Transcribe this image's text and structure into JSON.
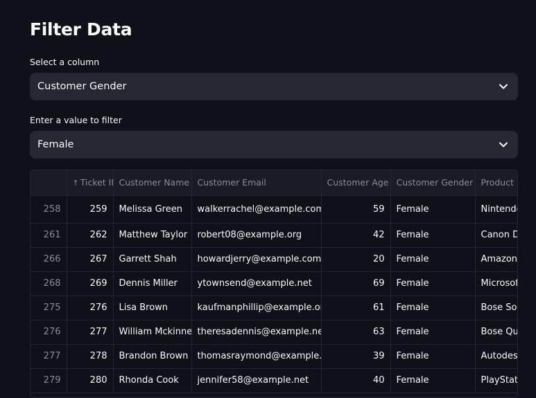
{
  "page": {
    "title": "Filter Data"
  },
  "column_select": {
    "label": "Select a column",
    "value": "Customer Gender"
  },
  "value_select": {
    "label": "Enter a value to filter",
    "value": "Female"
  },
  "table": {
    "sort_indicator": "↑",
    "headers": [
      "",
      "Ticket ID",
      "Customer Name",
      "Customer Email",
      "Customer Age",
      "Customer Gender",
      "Product Purchased"
    ],
    "rows": [
      [
        "258",
        "259",
        "Melissa Green",
        "walkerrachel@example.com",
        "59",
        "Female",
        "Nintendo Switch"
      ],
      [
        "261",
        "262",
        "Matthew Taylor",
        "robert08@example.org",
        "42",
        "Female",
        "Canon DSLR Camera"
      ],
      [
        "266",
        "267",
        "Garrett Shah",
        "howardjerry@example.com",
        "20",
        "Female",
        "Amazon Echo"
      ],
      [
        "268",
        "269",
        "Dennis Miller",
        "ytownsend@example.net",
        "69",
        "Female",
        "Microsoft Office"
      ],
      [
        "275",
        "276",
        "Lisa Brown",
        "kaufmanphillip@example.org",
        "61",
        "Female",
        "Bose SoundLink Speaker"
      ],
      [
        "276",
        "277",
        "William Mckinney",
        "theresadennis@example.net",
        "63",
        "Female",
        "Bose QuietComfort"
      ],
      [
        "277",
        "278",
        "Brandon Brown",
        "thomasraymond@example.net",
        "39",
        "Female",
        "Autodesk AutoCAD"
      ],
      [
        "279",
        "280",
        "Rhonda Cook",
        "jennifer58@example.net",
        "40",
        "Female",
        "PlayStation"
      ]
    ]
  }
}
